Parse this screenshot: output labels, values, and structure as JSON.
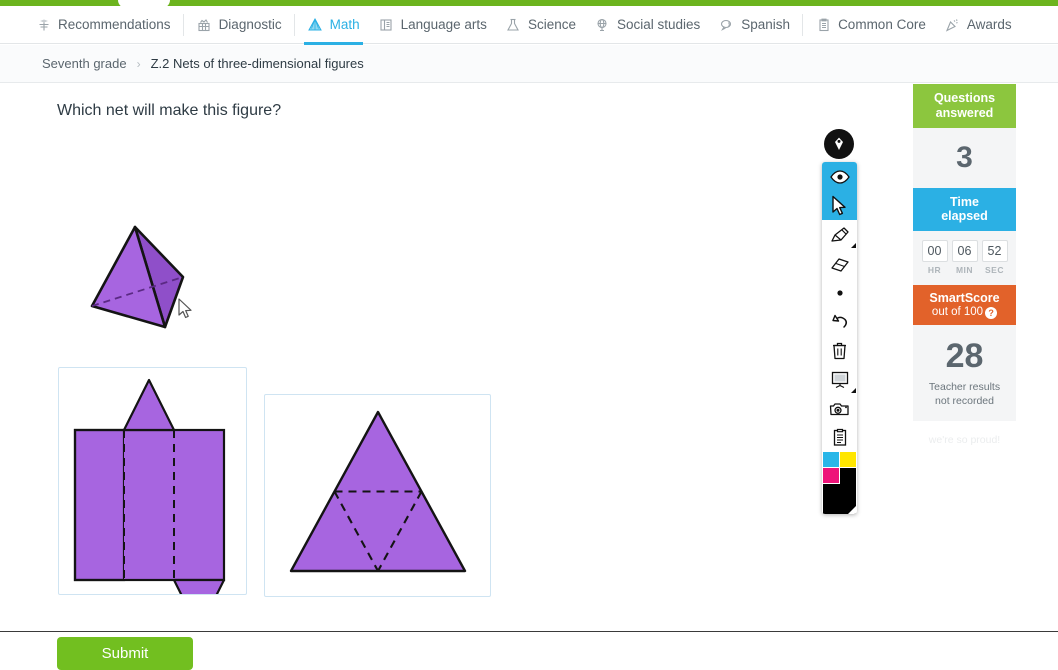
{
  "top_bar": {
    "accent_color": "#6cb41e"
  },
  "nav": {
    "tabs": [
      {
        "label": "Recommendations",
        "icon": "recommendations-icon",
        "active": false
      },
      {
        "label": "Diagnostic",
        "icon": "diagnostic-icon",
        "active": false
      },
      {
        "label": "Math",
        "icon": "math-pyramid-icon",
        "active": true
      },
      {
        "label": "Language arts",
        "icon": "book-icon",
        "active": false
      },
      {
        "label": "Science",
        "icon": "flask-icon",
        "active": false
      },
      {
        "label": "Social studies",
        "icon": "globe-icon",
        "active": false
      },
      {
        "label": "Spanish",
        "icon": "speech-bubbles-icon",
        "active": false
      },
      {
        "label": "Common Core",
        "icon": "clipboard-list-icon",
        "active": false
      },
      {
        "label": "Awards",
        "icon": "party-popper-icon",
        "active": false
      }
    ],
    "active_color": "#2bb0e4"
  },
  "breadcrumb": {
    "grade": "Seventh grade",
    "separator": "›",
    "skill": "Z.2 Nets of three-dimensional figures"
  },
  "question": {
    "prompt": "Which net will make this figure?",
    "figure": "tetrahedron",
    "fill_color": "#a765e0",
    "stroke_color": "#141414"
  },
  "answers": {
    "options": [
      {
        "name": "triangular-prism-net",
        "description": "Net of a triangular prism: three rectangles in a row with one triangle above the middle rectangle and one triangle below the right rectangle"
      },
      {
        "name": "tetrahedron-net",
        "description": "Net of a tetrahedron: large triangle subdivided by dashed lines into four smaller triangles"
      }
    ],
    "selected": null,
    "border_color": "#cfe4f2"
  },
  "submit": {
    "label": "Submit",
    "color": "#72bf20"
  },
  "toolbar": {
    "badge": "pen-nib-badge",
    "tools": [
      {
        "name": "eye-visibility-icon",
        "label": "Show/hide drawings",
        "selected": true,
        "has_submenu": false
      },
      {
        "name": "cursor-pointer-icon",
        "label": "Select",
        "selected": true,
        "has_submenu": false
      },
      {
        "name": "marker-pen-icon",
        "label": "Pen",
        "selected": false,
        "has_submenu": true
      },
      {
        "name": "eraser-icon",
        "label": "Eraser",
        "selected": false,
        "has_submenu": false
      },
      {
        "name": "dot-size-icon",
        "label": "Line width",
        "selected": false,
        "has_submenu": false
      },
      {
        "name": "undo-arrow-icon",
        "label": "Undo",
        "selected": false,
        "has_submenu": false
      },
      {
        "name": "trash-can-icon",
        "label": "Clear all",
        "selected": false,
        "has_submenu": false
      },
      {
        "name": "whiteboard-icon",
        "label": "Whiteboard",
        "selected": false,
        "has_submenu": true
      },
      {
        "name": "camera-icon",
        "label": "Snapshot",
        "selected": false,
        "has_submenu": false
      },
      {
        "name": "clipboard-icon",
        "label": "Notes",
        "selected": false,
        "has_submenu": false
      }
    ],
    "palette": {
      "cyan": "#29b6e8",
      "yellow": "#ffe600",
      "magenta": "#ee1379",
      "black": "#000000",
      "selected": "black"
    }
  },
  "score_panel": {
    "questions_answered": {
      "title_line1": "Questions",
      "title_line2": "answered",
      "value": "3",
      "color": "#8cc63e"
    },
    "time_elapsed": {
      "title_line1": "Time",
      "title_line2": "elapsed",
      "color": "#2bb0e4",
      "hours": "00",
      "minutes": "06",
      "seconds": "52",
      "hours_label": "HR",
      "minutes_label": "MIN",
      "seconds_label": "SEC"
    },
    "smartscore": {
      "title": "SmartScore",
      "subtitle": "out of 100",
      "help": "?",
      "value": "28",
      "color": "#e2622a",
      "teacher_note_line1": "Teacher results",
      "teacher_note_line2": "not recorded",
      "faded_note": "we're so proud!"
    }
  }
}
